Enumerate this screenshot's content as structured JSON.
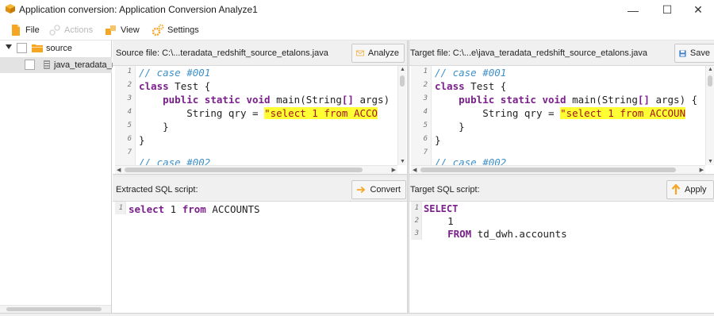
{
  "window": {
    "title": "Application conversion: Application Conversion Analyze1",
    "minimize_glyph": "—",
    "maximize_glyph": "☐",
    "close_glyph": "✕"
  },
  "menu": {
    "file": "File",
    "actions": "Actions",
    "view": "View",
    "settings": "Settings"
  },
  "tree": {
    "root_label": "source",
    "child_label": "java_teradata_re"
  },
  "source_pane": {
    "label": "Source file: C:\\...teradata_redshift_source_etalons.java",
    "button": "Analyze",
    "lines": [
      {
        "n": "1"
      },
      {
        "n": "2"
      },
      {
        "n": "3"
      },
      {
        "n": "4"
      },
      {
        "n": "5"
      },
      {
        "n": "6"
      },
      {
        "n": "7"
      }
    ],
    "code": {
      "l1": "// case #001",
      "l2_kw": "class",
      "l2_rest": " Test {",
      "l3_kw": "public static void",
      "l3_rest": " main(String",
      "l3_br": "[]",
      "l3_rest2": " args)",
      "l4_pre": "String qry = ",
      "l4_str": "\"select 1 from ACCO",
      "l5": "}",
      "l6": "}",
      "l8": "// case #002"
    }
  },
  "target_pane": {
    "label": "Target file: C:\\...e\\java_teradata_redshift_source_etalons.java",
    "button": "Save",
    "code": {
      "l1": "// case #001",
      "l2_kw": "class",
      "l2_rest": " Test {",
      "l3_kw": "public static void",
      "l3_rest": " main(String",
      "l3_br": "[]",
      "l3_rest2": " args) {",
      "l4_pre": "String qry = ",
      "l4_str": "\"select 1 from ACCOUN",
      "l5": "}",
      "l6": "}",
      "l8": "// case #002"
    }
  },
  "extracted_pane": {
    "label": "Extracted SQL script:",
    "button": "Convert",
    "line_n": "1",
    "sql_kw1": "select",
    "sql_mid": " 1 ",
    "sql_kw2": "from",
    "sql_rest": " ACCOUNTS"
  },
  "target_sql_pane": {
    "label": "Target SQL script:",
    "button": "Apply",
    "n1": "1",
    "n2": "2",
    "n3": "3",
    "l1_kw": "SELECT",
    "l2": "1",
    "l3_kw": "FROM",
    "l3_rest": " td_dwh.accounts"
  },
  "colors": {
    "accent_orange": "#f5a623",
    "keyword": "#7a1f8b",
    "comment": "#3e8fc7",
    "string_highlight": "#ffff33"
  }
}
